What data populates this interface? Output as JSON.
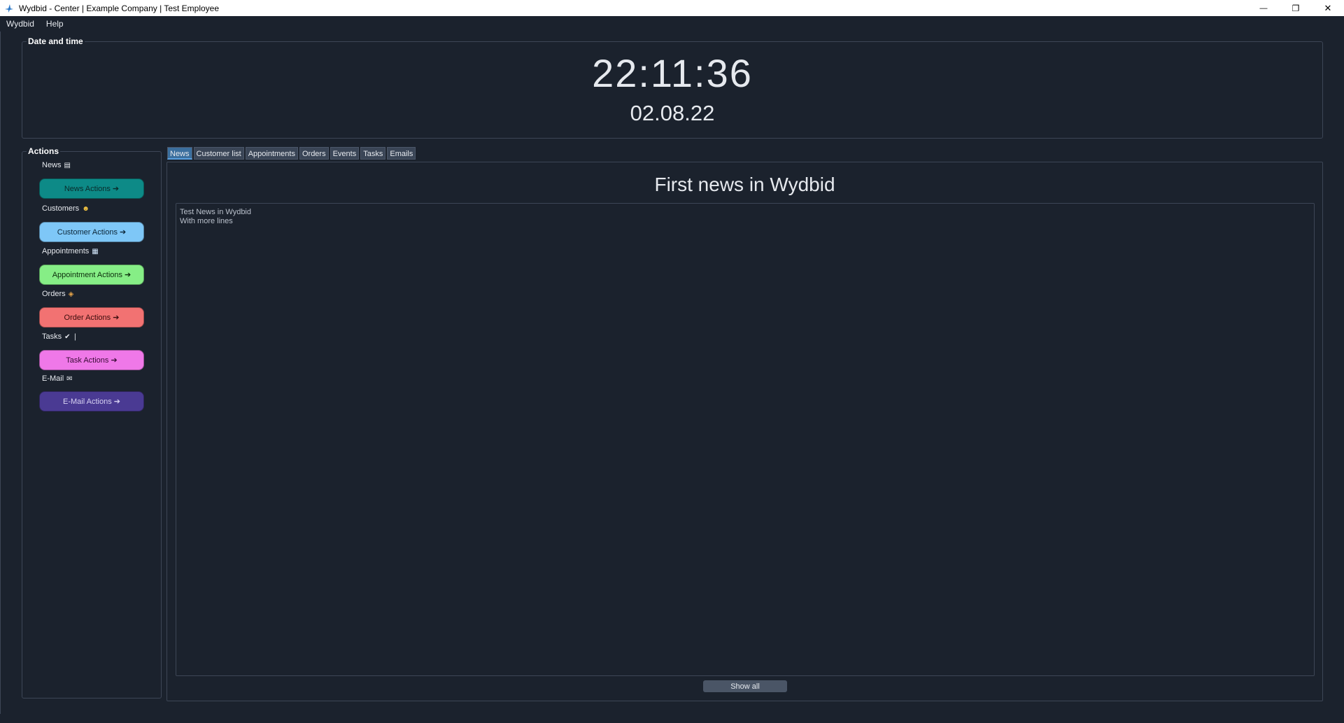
{
  "window": {
    "title": "Wydbid - Center | Example Company | Test Employee",
    "minimize_glyph": "—",
    "maximize_glyph": "❐",
    "close_glyph": "✕"
  },
  "menu": {
    "items": [
      "Wydbid",
      "Help"
    ]
  },
  "datetime": {
    "group_title": "Date and time",
    "time": "22:11:36",
    "date": "02.08.22"
  },
  "actions": {
    "group_title": "Actions",
    "sections": [
      {
        "label": "News",
        "icon": "newspaper-icon",
        "glyph": "▤",
        "button": "News Actions ➔",
        "color": "#0d8a87",
        "text_color": "#0a2a2a"
      },
      {
        "label": "Customers",
        "icon": "person-icon",
        "glyph": "☻",
        "button": "Customer Actions ➔",
        "color": "#7ec7f7",
        "text_color": "#0b2536"
      },
      {
        "label": "Appointments",
        "icon": "calendar-icon",
        "glyph": "▦",
        "button": "Appointment Actions ➔",
        "color": "#86ee86",
        "text_color": "#0c2d0c"
      },
      {
        "label": "Orders",
        "icon": "package-icon",
        "glyph": "◈",
        "button": "Order Actions ➔",
        "color": "#f27272",
        "text_color": "#3a0d0d"
      },
      {
        "label": "Tasks",
        "icon": "checkmark-icon",
        "glyph": "✔ ❘",
        "button": "Task Actions ➔",
        "color": "#ef78e8",
        "text_color": "#3a0c36"
      },
      {
        "label": "E-Mail",
        "icon": "email-icon",
        "glyph": "✉",
        "button": "E-Mail Actions ➔",
        "color": "#4a3a93",
        "text_color": "#d7d2f2"
      }
    ]
  },
  "tabs": {
    "items": [
      "News",
      "Customer list",
      "Appointments",
      "Orders",
      "Events",
      "Tasks",
      "Emails"
    ],
    "active": "News"
  },
  "news": {
    "title": "First news in Wydbid",
    "body_line1": "Test News in Wydbid",
    "body_line2": "With more lines",
    "show_all": "Show all"
  }
}
